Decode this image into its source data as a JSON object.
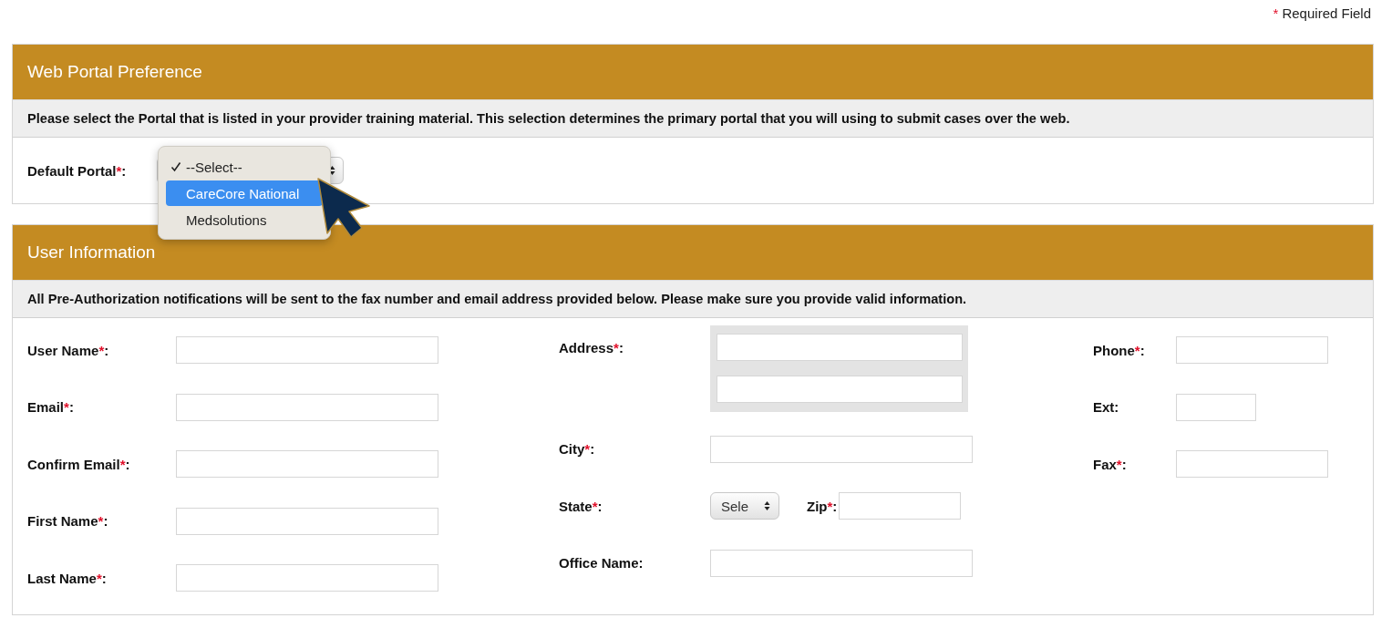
{
  "required_note": {
    "mark": "*",
    "text": "Required Field"
  },
  "portal_section": {
    "title": "Web Portal Preference",
    "notice": "Please select the Portal that is listed in your provider training material. This selection determines the primary portal that you will using to submit cases over the web.",
    "field": {
      "label": "Default Portal",
      "mark": "*",
      "colon": ":"
    },
    "dropdown": {
      "options": [
        {
          "label": "--Select--",
          "checked": true,
          "selected": false
        },
        {
          "label": "CareCore National",
          "checked": false,
          "selected": true
        },
        {
          "label": "Medsolutions",
          "checked": false,
          "selected": false
        }
      ]
    }
  },
  "user_section": {
    "title": "User Information",
    "notice": "All Pre-Authorization notifications will be sent to the fax number and email address provided below. Please make sure you provide valid information.",
    "columns": [
      [
        {
          "kind": "long_text",
          "label": "User Name",
          "mark": "*",
          "colon": ":"
        },
        {
          "kind": "long_text",
          "label": "Email",
          "mark": "*",
          "colon": ":"
        },
        {
          "kind": "long_text",
          "label": "Confirm Email",
          "mark": "*",
          "colon": ":"
        },
        {
          "kind": "long_text",
          "label": "First Name",
          "mark": "*",
          "colon": ":"
        },
        {
          "kind": "long_text",
          "label": "Last Name",
          "mark": "*",
          "colon": ":"
        }
      ],
      [
        {
          "kind": "address",
          "label": "Address",
          "mark": "*",
          "colon": ":"
        },
        {
          "kind": "long_text",
          "label": "City",
          "mark": "*",
          "colon": ":"
        },
        {
          "kind": "state_zip",
          "label": "State",
          "mark": "*",
          "colon": ":",
          "value": "Sele",
          "zip": {
            "label": "Zip",
            "mark": "*",
            "colon": ":"
          }
        },
        {
          "kind": "long_text",
          "label": "Office Name",
          "colon": ":"
        }
      ],
      [
        {
          "kind": "medium_text",
          "label": "Phone",
          "mark": "*",
          "colon": ":"
        },
        {
          "kind": "short_text",
          "label": "Ext",
          "colon": ":"
        },
        {
          "kind": "medium_text",
          "label": "Fax",
          "mark": "*",
          "colon": ":"
        }
      ]
    ]
  }
}
